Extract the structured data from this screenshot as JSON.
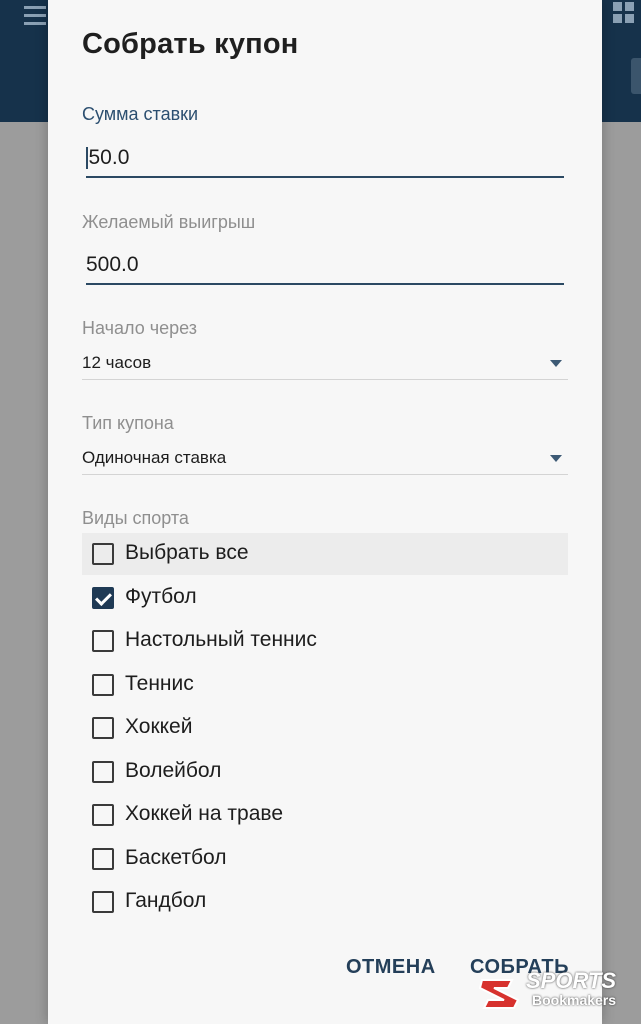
{
  "dialog": {
    "title": "Собрать купон",
    "stake": {
      "label": "Сумма ставки",
      "value": "50.0"
    },
    "win": {
      "label": "Желаемый выигрыш",
      "value": "500.0"
    },
    "start": {
      "label": "Начало через",
      "value": "12 часов"
    },
    "type": {
      "label": "Тип купона",
      "value": "Одиночная ставка"
    },
    "sports": {
      "label": "Виды спорта",
      "items": [
        {
          "label": "Выбрать все",
          "checked": false
        },
        {
          "label": "Футбол",
          "checked": true
        },
        {
          "label": "Настольный теннис",
          "checked": false
        },
        {
          "label": "Теннис",
          "checked": false
        },
        {
          "label": "Хоккей",
          "checked": false
        },
        {
          "label": "Волейбол",
          "checked": false
        },
        {
          "label": "Хоккей на траве",
          "checked": false
        },
        {
          "label": "Баскетбол",
          "checked": false
        },
        {
          "label": "Гандбол",
          "checked": false
        }
      ]
    },
    "cancel_label": "ОТМЕНА",
    "submit_label": "СОБРАТЬ"
  },
  "watermark": {
    "line1": "SPORTS",
    "line2": "Bookmakers"
  },
  "colors": {
    "appbar": "#16324b",
    "accent": "#243f59"
  }
}
